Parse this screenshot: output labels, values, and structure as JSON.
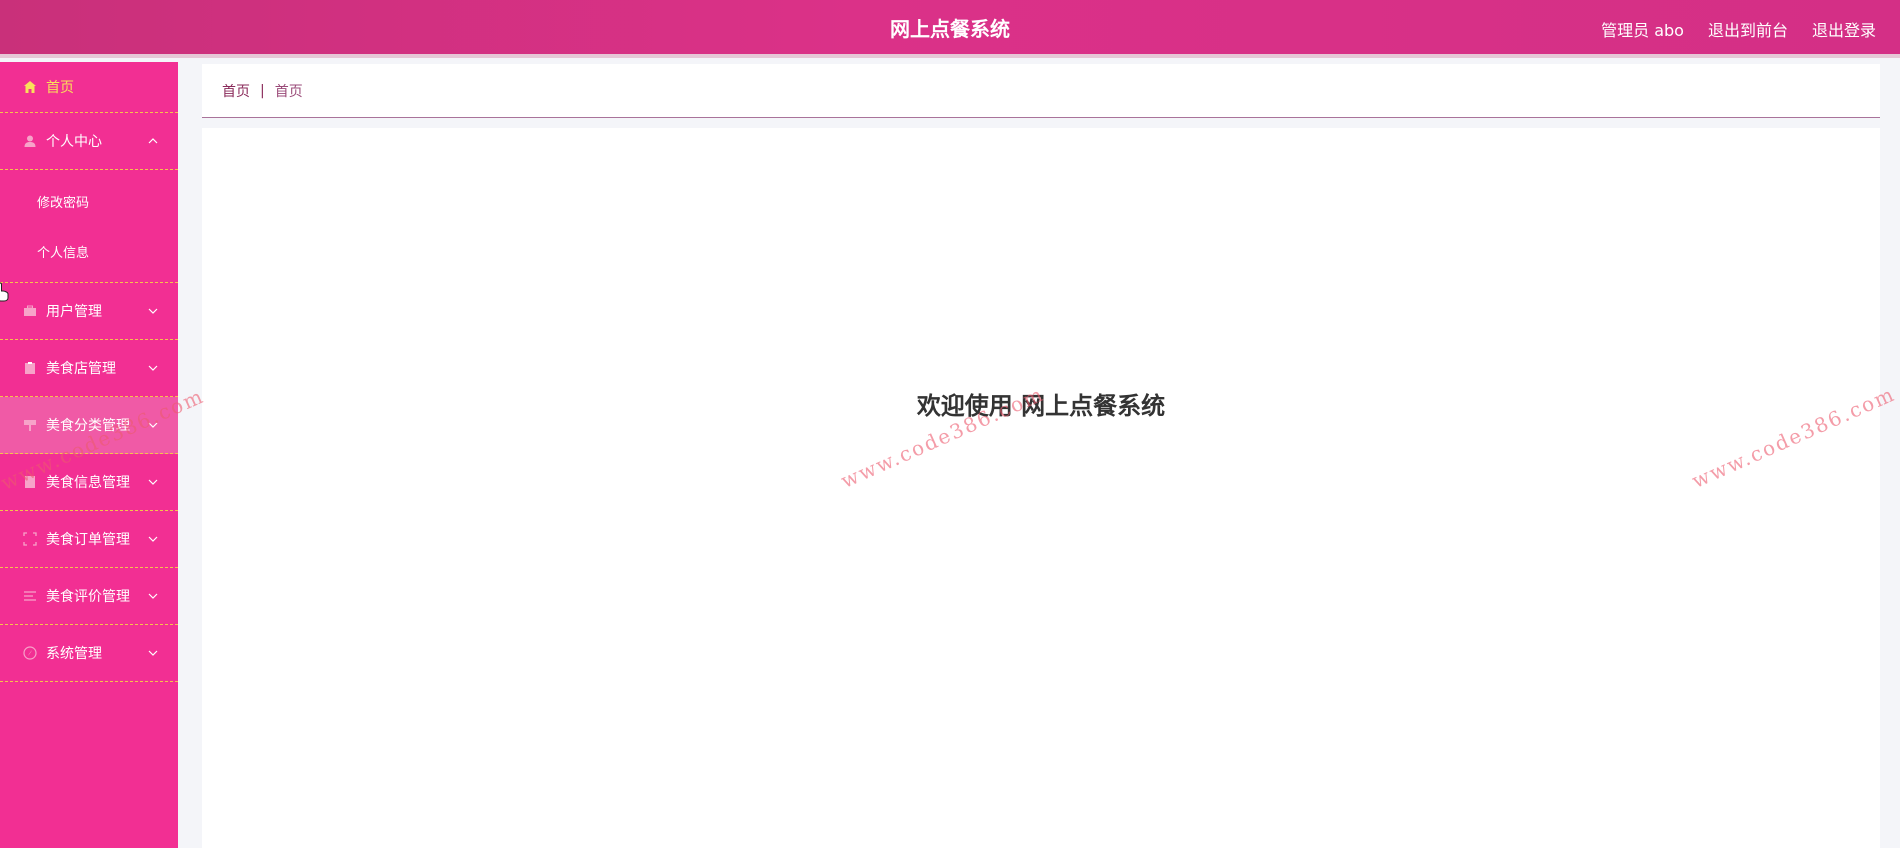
{
  "header": {
    "title": "网上点餐系统",
    "user_label": "管理员 abo",
    "front_link": "退出到前台",
    "logout_link": "退出登录"
  },
  "sidebar": {
    "items": [
      {
        "label": "首页",
        "icon": "home-icon"
      },
      {
        "label": "个人中心",
        "icon": "user-icon",
        "expanded": true,
        "children": [
          {
            "label": "修改密码"
          },
          {
            "label": "个人信息"
          }
        ]
      },
      {
        "label": "用户管理",
        "icon": "briefcase-icon"
      },
      {
        "label": "美食店管理",
        "icon": "clipboard-icon"
      },
      {
        "label": "美食分类管理",
        "icon": "signpost-icon"
      },
      {
        "label": "美食信息管理",
        "icon": "document-icon"
      },
      {
        "label": "美食订单管理",
        "icon": "scan-icon"
      },
      {
        "label": "美食评价管理",
        "icon": "list-icon"
      },
      {
        "label": "系统管理",
        "icon": "compass-icon"
      }
    ]
  },
  "breadcrumb": {
    "home": "首页",
    "separator": "|",
    "current": "首页"
  },
  "main": {
    "welcome": "欢迎使用 网上点餐系统"
  },
  "watermark": {
    "text": "www.code386.com"
  },
  "colors": {
    "sidebar": "#f22f93",
    "topbar": "#d42f86",
    "menu_active": "#f9e05a",
    "divider": "#f6c24c"
  }
}
